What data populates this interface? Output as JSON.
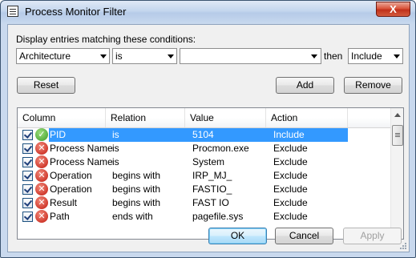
{
  "window": {
    "title": "Process Monitor Filter",
    "close_glyph": "X"
  },
  "filter": {
    "prompt": "Display entries matching these conditions:",
    "column_select": "Architecture",
    "relation_select": "is",
    "value_input": "",
    "then_label": "then",
    "action_select": "Include"
  },
  "buttons": {
    "reset": "Reset",
    "add": "Add",
    "remove": "Remove",
    "ok": "OK",
    "cancel": "Cancel",
    "apply": "Apply"
  },
  "table": {
    "headers": [
      "Column",
      "Relation",
      "Value",
      "Action"
    ],
    "rows": [
      {
        "column": "PID",
        "relation": "is",
        "value": "5104",
        "action": "Include",
        "icon": "include-check-icon",
        "selected": true
      },
      {
        "column": "Process Name",
        "relation": "is",
        "value": "Procmon.exe",
        "action": "Exclude",
        "icon": "exclude-x-icon"
      },
      {
        "column": "Process Name",
        "relation": "is",
        "value": "System",
        "action": "Exclude",
        "icon": "exclude-x-icon"
      },
      {
        "column": "Operation",
        "relation": "begins with",
        "value": "IRP_MJ_",
        "action": "Exclude",
        "icon": "exclude-x-icon"
      },
      {
        "column": "Operation",
        "relation": "begins with",
        "value": "FASTIO_",
        "action": "Exclude",
        "icon": "exclude-x-icon"
      },
      {
        "column": "Result",
        "relation": "begins with",
        "value": "FAST IO",
        "action": "Exclude",
        "icon": "exclude-x-icon"
      },
      {
        "column": "Path",
        "relation": "ends with",
        "value": "pagefile.sys",
        "action": "Exclude",
        "icon": "exclude-x-icon"
      }
    ]
  },
  "colors": {
    "selection": "#3399ff",
    "include_icon": "#3a9a28",
    "exclude_icon": "#c2180d",
    "close_button": "#c0301a"
  }
}
